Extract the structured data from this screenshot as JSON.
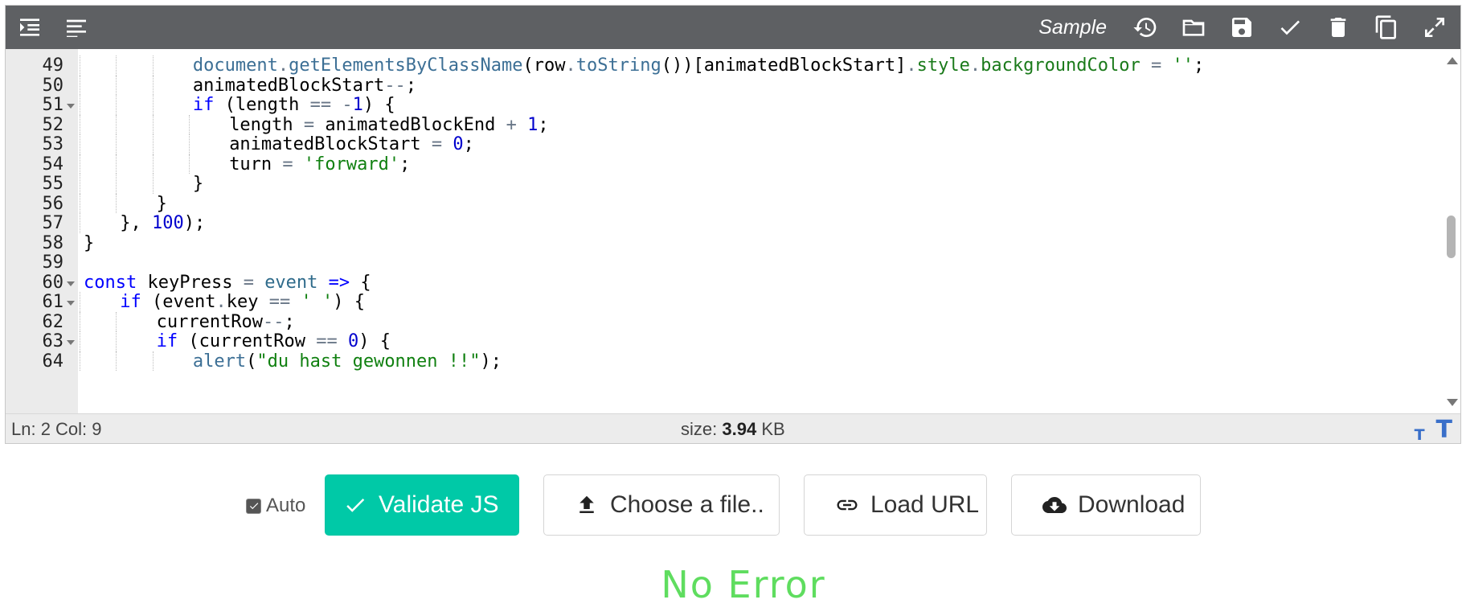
{
  "toolbar": {
    "title": "Sample",
    "buttons": [
      "indent-icon",
      "format-icon",
      "history-icon",
      "folder-icon",
      "save-icon",
      "check-icon",
      "trash-icon",
      "copy-icon",
      "expand-icon"
    ]
  },
  "code": {
    "lines": [
      {
        "n": "49",
        "fold": false,
        "indent": 3
      },
      {
        "n": "50",
        "fold": false,
        "indent": 3
      },
      {
        "n": "51",
        "fold": true,
        "indent": 3
      },
      {
        "n": "52",
        "fold": false,
        "indent": 4
      },
      {
        "n": "53",
        "fold": false,
        "indent": 4
      },
      {
        "n": "54",
        "fold": false,
        "indent": 4
      },
      {
        "n": "55",
        "fold": false,
        "indent": 3
      },
      {
        "n": "56",
        "fold": false,
        "indent": 2
      },
      {
        "n": "57",
        "fold": false,
        "indent": 1
      },
      {
        "n": "58",
        "fold": false,
        "indent": 0
      },
      {
        "n": "59",
        "fold": false,
        "indent": 0
      },
      {
        "n": "60",
        "fold": true,
        "indent": 0
      },
      {
        "n": "61",
        "fold": true,
        "indent": 1
      },
      {
        "n": "62",
        "fold": false,
        "indent": 2
      },
      {
        "n": "63",
        "fold": true,
        "indent": 2
      },
      {
        "n": "64",
        "fold": false,
        "indent": 3
      }
    ],
    "tokens": [
      [
        [
          "t-fn",
          "document"
        ],
        [
          "",
          ""
        ],
        [
          "t-op",
          "."
        ],
        [
          "t-fn",
          "getElementsByClassName"
        ],
        [
          "",
          "(row"
        ],
        [
          "t-op",
          "."
        ],
        [
          "t-fn",
          "toString"
        ],
        [
          "",
          "())[animatedBlockStart]"
        ],
        [
          "t-op",
          "."
        ],
        [
          "t-prop",
          "style"
        ],
        [
          "t-op",
          "."
        ],
        [
          "t-prop",
          "backgroundColor"
        ],
        [
          "",
          " "
        ],
        [
          "t-op",
          "="
        ],
        [
          "",
          " "
        ],
        [
          "t-str",
          "''"
        ],
        [
          "",
          ";"
        ]
      ],
      [
        [
          "",
          "animatedBlockStart"
        ],
        [
          "t-op",
          "--"
        ],
        [
          "",
          ";"
        ]
      ],
      [
        [
          "t-kw",
          "if"
        ],
        [
          "",
          " (length "
        ],
        [
          "t-op",
          "=="
        ],
        [
          "",
          " "
        ],
        [
          "t-op",
          "-"
        ],
        [
          "t-num",
          "1"
        ],
        [
          "",
          ") {"
        ]
      ],
      [
        [
          "",
          "length "
        ],
        [
          "t-op",
          "="
        ],
        [
          "",
          " animatedBlockEnd "
        ],
        [
          "t-op",
          "+"
        ],
        [
          "",
          " "
        ],
        [
          "t-num",
          "1"
        ],
        [
          "",
          ";"
        ]
      ],
      [
        [
          "",
          "animatedBlockStart "
        ],
        [
          "t-op",
          "="
        ],
        [
          "",
          " "
        ],
        [
          "t-num",
          "0"
        ],
        [
          "",
          ";"
        ]
      ],
      [
        [
          "",
          "turn "
        ],
        [
          "t-op",
          "="
        ],
        [
          "",
          " "
        ],
        [
          "t-str",
          "'forward'"
        ],
        [
          "",
          ";"
        ]
      ],
      [
        [
          "",
          "}"
        ]
      ],
      [
        [
          "",
          "}"
        ]
      ],
      [
        [
          "",
          "}, "
        ],
        [
          "t-num",
          "100"
        ],
        [
          "",
          ");"
        ]
      ],
      [
        [
          "",
          "}"
        ]
      ],
      [],
      [
        [
          "t-kw",
          "const"
        ],
        [
          "",
          " keyPress "
        ],
        [
          "t-op",
          "="
        ],
        [
          "",
          " "
        ],
        [
          "t-var",
          "event"
        ],
        [
          "",
          " "
        ],
        [
          "t-kw",
          "=>"
        ],
        [
          "",
          " {"
        ]
      ],
      [
        [
          "t-kw",
          "if"
        ],
        [
          "",
          " (event"
        ],
        [
          "t-op",
          "."
        ],
        [
          "",
          "key "
        ],
        [
          "t-op",
          "=="
        ],
        [
          "",
          " "
        ],
        [
          "t-str",
          "' '"
        ],
        [
          "",
          ") {"
        ]
      ],
      [
        [
          "",
          "currentRow"
        ],
        [
          "t-op",
          "--"
        ],
        [
          "",
          ";"
        ]
      ],
      [
        [
          "t-kw",
          "if"
        ],
        [
          "",
          " (currentRow "
        ],
        [
          "t-op",
          "=="
        ],
        [
          "",
          " "
        ],
        [
          "t-num",
          "0"
        ],
        [
          "",
          ") {"
        ]
      ],
      [
        [
          "t-fn",
          "alert"
        ],
        [
          "",
          "("
        ],
        [
          "t-str",
          "\"du hast gewonnen !!\""
        ],
        [
          "",
          ");"
        ]
      ]
    ]
  },
  "status": {
    "position": "Ln: 2 Col: 9",
    "size_label": "size:",
    "size_value": "3.94",
    "size_unit": "KB",
    "font_small": "T",
    "font_large": "T"
  },
  "actions": {
    "auto_label": "Auto",
    "auto_checked": true,
    "validate_label": "Validate JS",
    "choose_file_label": "Choose a file..",
    "load_url_label": "Load URL",
    "download_label": "Download"
  },
  "result": {
    "message": "No Error",
    "color": "#5fdd5f"
  },
  "colors": {
    "toolbar_bg": "#5e6063",
    "accent": "#00c9a7"
  }
}
